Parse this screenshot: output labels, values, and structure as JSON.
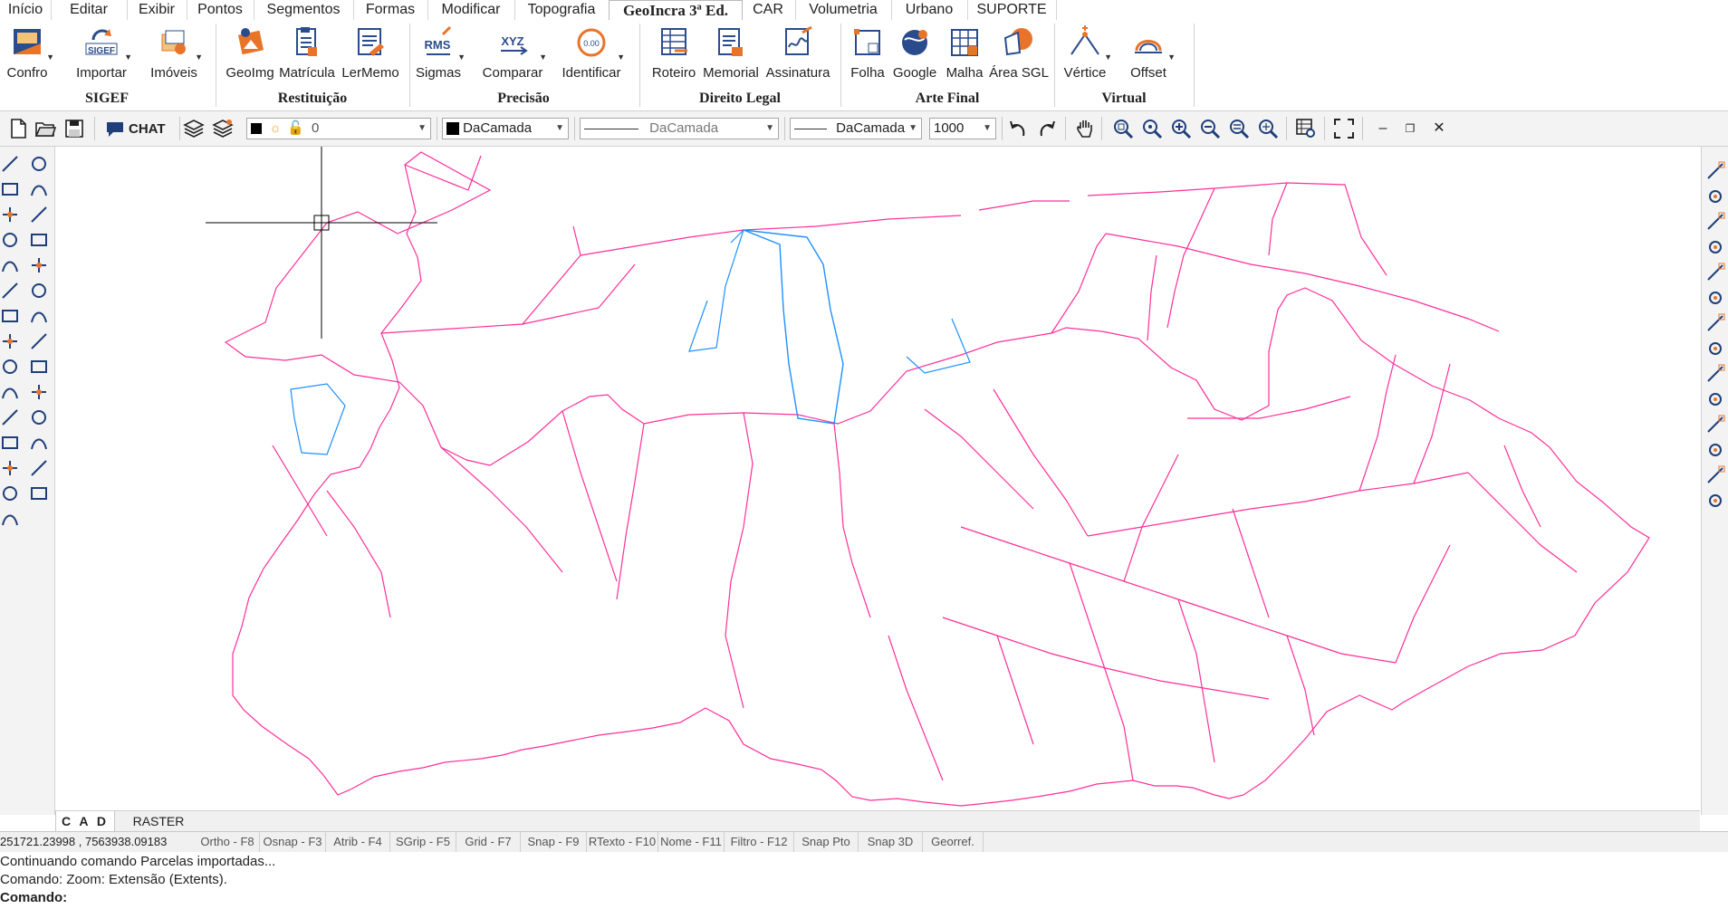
{
  "menu": {
    "tabs": [
      "Início",
      "Editar",
      "Exibir",
      "Pontos",
      "Segmentos",
      "Formas",
      "Modificar",
      "Topografia",
      "GeoIncra 3ª Ed.",
      "CAR",
      "Volumetria",
      "Urbano",
      "SUPORTE"
    ],
    "active": "GeoIncra 3ª Ed."
  },
  "ribbon": {
    "groups": {
      "sigef": "SIGEF",
      "restituicao": "Restituição",
      "precisao": "Precisão",
      "direito": "Direito Legal",
      "arte": "Arte Final",
      "virtual": "Virtual"
    },
    "buttons": {
      "confro": "Confro",
      "importar": "Importar",
      "imoveis": "Imóveis",
      "geoimg": "GeoImg",
      "matricula": "Matrícula",
      "lermemo": "LerMemo",
      "sigmas": "Sigmas",
      "comparar": "Comparar",
      "identificar": "Identificar",
      "roteiro": "Roteiro",
      "memorial": "Memorial",
      "assinatura": "Assinatura",
      "folha": "Folha",
      "google": "Google",
      "malha": "Malha",
      "areasgl": "Área SGL",
      "vertice": "Vértice",
      "offset": "Offset"
    },
    "icon_text": {
      "importar": "SIGEF",
      "sigmas": "RMS",
      "comparar": "XYZ",
      "identificar": "0.00"
    }
  },
  "toolbar": {
    "chat_label": "CHAT",
    "layer_value": "0",
    "color_value": "DaCamada",
    "linetype_value": "DaCamada",
    "lineweight_value": "DaCamada",
    "scale_value": "1000"
  },
  "view_tabs": [
    "C A D",
    "RASTER"
  ],
  "status": {
    "coords": "251721.23998 , 7563938.09183",
    "toggles": [
      "Ortho - F8",
      "Osnap - F3",
      "Atrib - F4",
      "SGrip - F5",
      "Grid - F7",
      "Snap - F9",
      "RTexto - F10",
      "Nome - F11",
      "Filtro - F12",
      "Snap Pto",
      "Snap 3D",
      "Georref."
    ]
  },
  "command": {
    "line1": "Continuando comando Parcelas importadas...",
    "line2": "Comando: Zoom: Extensão (Extents).",
    "prompt": "Comando:"
  },
  "colors": {
    "parcel_line": "#ff2f9a",
    "highlight_line": "#1e90ff",
    "accent_orange": "#e8742a",
    "icon_blue": "#2b4c8c"
  }
}
